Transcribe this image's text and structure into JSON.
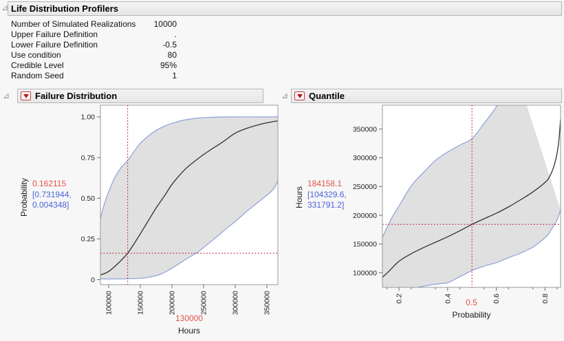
{
  "header": {
    "title": "Life Distribution Profilers"
  },
  "summary_table": {
    "rows": [
      {
        "label": "Number of Simulated Realizations",
        "value": "10000"
      },
      {
        "label": "Upper Failure Definition",
        "value": "."
      },
      {
        "label": "Lower Failure Definition",
        "value": "-0.5"
      },
      {
        "label": "Use condition",
        "value": "80"
      },
      {
        "label": "Credible Level",
        "value": "95%"
      },
      {
        "label": "Random Seed",
        "value": "1"
      }
    ]
  },
  "panels": [
    {
      "title": "Failure Distribution",
      "y_axis_title": "Probability",
      "x_axis_title": "Hours",
      "current_y": "0.162115",
      "interval": [
        "[0.731944,",
        "0.004348]"
      ],
      "current_x": "130000"
    },
    {
      "title": "Quantile",
      "y_axis_title": "Hours",
      "x_axis_title": "Probability",
      "current_y": "184158.1",
      "interval": [
        "[104329.6,",
        "331791.2]"
      ],
      "current_x": "0.5"
    }
  ],
  "colors": {
    "red_value": "#e4524b",
    "blue_interval": "#4a63d8",
    "crosshair": "#c22136",
    "curve": "#303030",
    "band_edge": "#8ba0d8",
    "band_fill": "#e0e0e0",
    "frame": "#9a9a9a",
    "tick": "#6e6e6e"
  },
  "chart_data": [
    {
      "type": "line",
      "title": "Failure Distribution",
      "xlabel": "Hours",
      "ylabel": "Probability",
      "xlim": [
        86957,
        367391
      ],
      "ylim": [
        -0.031,
        1.072
      ],
      "x_ticks": [
        100000,
        150000,
        200000,
        250000,
        300000,
        350000
      ],
      "x_tick_labels": [
        "100000",
        "150000",
        "200000",
        "250000",
        "300000",
        "350000"
      ],
      "x_minor_ticks": [],
      "y_ticks": [
        0,
        0.25,
        0.5,
        0.75,
        1.0
      ],
      "y_tick_labels": [
        "0",
        "0.25",
        "0.50",
        "0.75",
        "1.00"
      ],
      "grid": false,
      "legend": "none",
      "series": [
        {
          "name": "estimate",
          "points": [
            [
              86957,
              0.028
            ],
            [
              100000,
              0.05
            ],
            [
              115000,
              0.1
            ],
            [
              130000,
              0.162
            ],
            [
              145000,
              0.25
            ],
            [
              160000,
              0.345
            ],
            [
              175000,
              0.44
            ],
            [
              190000,
              0.525
            ],
            [
              200000,
              0.585
            ],
            [
              220000,
              0.675
            ],
            [
              240000,
              0.74
            ],
            [
              260000,
              0.795
            ],
            [
              280000,
              0.845
            ],
            [
              300000,
              0.9
            ],
            [
              320000,
              0.932
            ],
            [
              340000,
              0.955
            ],
            [
              355000,
              0.967
            ],
            [
              367391,
              0.976
            ]
          ]
        },
        {
          "name": "upper",
          "points": [
            [
              86957,
              0.375
            ],
            [
              92000,
              0.45
            ],
            [
              100000,
              0.54
            ],
            [
              110000,
              0.63
            ],
            [
              120000,
              0.69
            ],
            [
              130000,
              0.732
            ],
            [
              140000,
              0.787
            ],
            [
              150000,
              0.838
            ],
            [
              162000,
              0.88
            ],
            [
              175000,
              0.917
            ],
            [
              190000,
              0.946
            ],
            [
              205000,
              0.966
            ],
            [
              220000,
              0.981
            ],
            [
              240000,
              0.992
            ],
            [
              260000,
              0.997
            ],
            [
              290000,
              1.0
            ],
            [
              367391,
              1.0
            ]
          ]
        },
        {
          "name": "lower",
          "points": [
            [
              86957,
              0.004
            ],
            [
              120000,
              0.004
            ],
            [
              140000,
              0.006
            ],
            [
              160000,
              0.012
            ],
            [
              180000,
              0.03
            ],
            [
              200000,
              0.07
            ],
            [
              220000,
              0.12
            ],
            [
              238000,
              0.162
            ],
            [
              250000,
              0.197
            ],
            [
              270000,
              0.26
            ],
            [
              285000,
              0.31
            ],
            [
              300000,
              0.357
            ],
            [
              320000,
              0.425
            ],
            [
              340000,
              0.487
            ],
            [
              355000,
              0.535
            ],
            [
              362000,
              0.565
            ],
            [
              367391,
              0.607
            ]
          ]
        }
      ],
      "crosshair": {
        "x": 130000,
        "y": 0.162115
      }
    },
    {
      "type": "line",
      "title": "Quantile",
      "xlabel": "Probability",
      "ylabel": "Hours",
      "xlim": [
        0.132,
        0.864
      ],
      "ylim": [
        74500,
        391500
      ],
      "x_ticks": [
        0.2,
        0.4,
        0.6,
        0.8
      ],
      "x_tick_labels": [
        "0.2",
        "0.4",
        "0.6",
        "0.8"
      ],
      "x_minor_ticks": [
        0.15,
        0.25,
        0.35,
        0.45,
        0.55,
        0.65,
        0.75,
        0.85
      ],
      "y_ticks": [
        100000,
        150000,
        200000,
        250000,
        300000,
        350000
      ],
      "y_tick_labels": [
        "100000",
        "150000",
        "200000",
        "250000",
        "300000",
        "350000"
      ],
      "grid": false,
      "legend": "none",
      "series": [
        {
          "name": "estimate",
          "points": [
            [
              0.132,
              92000
            ],
            [
              0.16,
              103000
            ],
            [
              0.2,
              120000
            ],
            [
              0.25,
              133000
            ],
            [
              0.3,
              143500
            ],
            [
              0.35,
              153000
            ],
            [
              0.4,
              162500
            ],
            [
              0.45,
              173000
            ],
            [
              0.5,
              184158
            ],
            [
              0.55,
              194000
            ],
            [
              0.6,
              203500
            ],
            [
              0.65,
              214500
            ],
            [
              0.7,
              227000
            ],
            [
              0.75,
              240500
            ],
            [
              0.8,
              257000
            ],
            [
              0.82,
              268000
            ],
            [
              0.84,
              290000
            ],
            [
              0.855,
              322000
            ],
            [
              0.864,
              367500
            ]
          ]
        },
        {
          "name": "upper",
          "points": [
            [
              0.132,
              161500
            ],
            [
              0.17,
              195000
            ],
            [
              0.2,
              216000
            ],
            [
              0.25,
              251000
            ],
            [
              0.3,
              274000
            ],
            [
              0.35,
              295500
            ],
            [
              0.4,
              310000
            ],
            [
              0.45,
              322000
            ],
            [
              0.5,
              333300
            ],
            [
              0.55,
              360000
            ],
            [
              0.604,
              391500
            ],
            [
              0.68,
              450000
            ]
          ]
        },
        {
          "name": "lower",
          "points": [
            [
              0.132,
              60000
            ],
            [
              0.2,
              65500
            ],
            [
              0.279,
              74500
            ],
            [
              0.32,
              78000
            ],
            [
              0.38,
              81500
            ],
            [
              0.404,
              83000
            ],
            [
              0.45,
              93000
            ],
            [
              0.503,
              104300
            ],
            [
              0.55,
              111500
            ],
            [
              0.602,
              117800
            ],
            [
              0.65,
              126000
            ],
            [
              0.701,
              134300
            ],
            [
              0.75,
              144500
            ],
            [
              0.78,
              153800
            ],
            [
              0.81,
              165000
            ],
            [
              0.83,
              178000
            ],
            [
              0.845,
              188000
            ],
            [
              0.855,
              197500
            ],
            [
              0.864,
              209700
            ]
          ]
        }
      ],
      "crosshair": {
        "x": 0.5,
        "y": 184158.1
      }
    }
  ]
}
